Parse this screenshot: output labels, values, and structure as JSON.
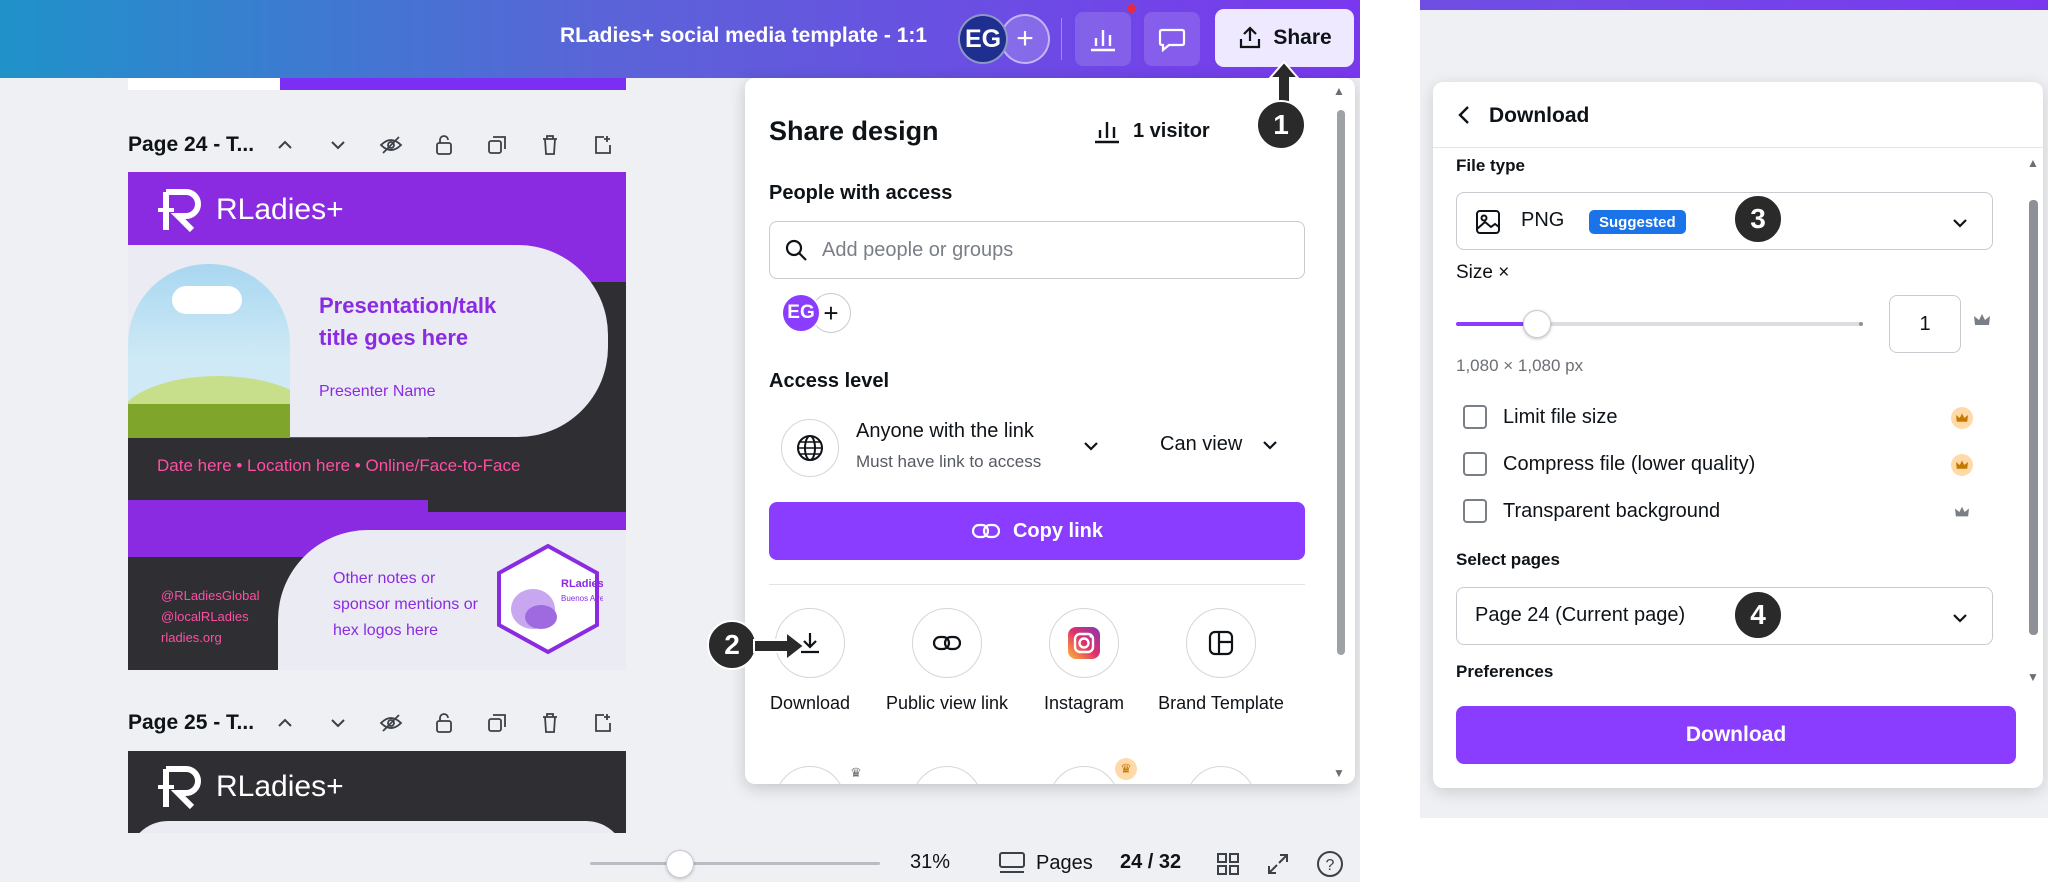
{
  "header": {
    "doc_title": "RLadies+ social media template - 1:1",
    "avatar_initials": "EG",
    "add_label": "+",
    "share_label": "Share"
  },
  "pages": {
    "page24_label": "Page 24 - T...",
    "page25_label": "Page 25 - T..."
  },
  "design": {
    "logo_text": "RLadies+",
    "title": "Presentation/talk title goes here",
    "presenter": "Presenter Name",
    "band": "Date here • Location here • Online/Face-to-Face",
    "handles": [
      "@RLadiesGlobal",
      "@localRLadies",
      "rladies.org"
    ],
    "notes": "Other notes or sponsor mentions or hex logos here",
    "hex_text": "RLadies+",
    "hex_subtext": "Buenos Aires"
  },
  "share": {
    "title": "Share design",
    "visitors": "1 visitor",
    "people_label": "People with access",
    "search_placeholder": "Add people or groups",
    "avatar_initials": "EG",
    "add_label": "+",
    "access_label": "Access level",
    "link_main": "Anyone with the link",
    "link_sub": "Must have link to access",
    "permission": "Can view",
    "copy_link": "Copy link",
    "options": [
      {
        "label": "Download",
        "icon": "download-icon"
      },
      {
        "label": "Public view link",
        "icon": "link-icon"
      },
      {
        "label": "Instagram",
        "icon": "instagram-icon"
      },
      {
        "label": "Brand Template",
        "icon": "brand-template-icon"
      }
    ]
  },
  "bottom": {
    "zoom": "31%",
    "pages_label": "Pages",
    "page_count": "24 / 32"
  },
  "steps": [
    "1",
    "2",
    "3",
    "4"
  ],
  "download": {
    "title": "Download",
    "file_type_label": "File type",
    "file_type": "PNG",
    "suggested": "Suggested",
    "size_label": "Size ×",
    "size_value": "1",
    "size_fraction": 0.2,
    "dims": "1,080 × 1,080 px",
    "limit_file_size": "Limit file size",
    "compress": "Compress file (lower quality)",
    "transparent": "Transparent background",
    "select_pages_label": "Select pages",
    "pages_value": "Page 24 (Current page)",
    "preferences_label": "Preferences",
    "download_button": "Download"
  },
  "colors": {
    "accent": "#8b3dff",
    "rladies_purple": "#8a2be2",
    "rladies_pink": "#ff4fa3",
    "badge_blue": "#1a73e8"
  }
}
